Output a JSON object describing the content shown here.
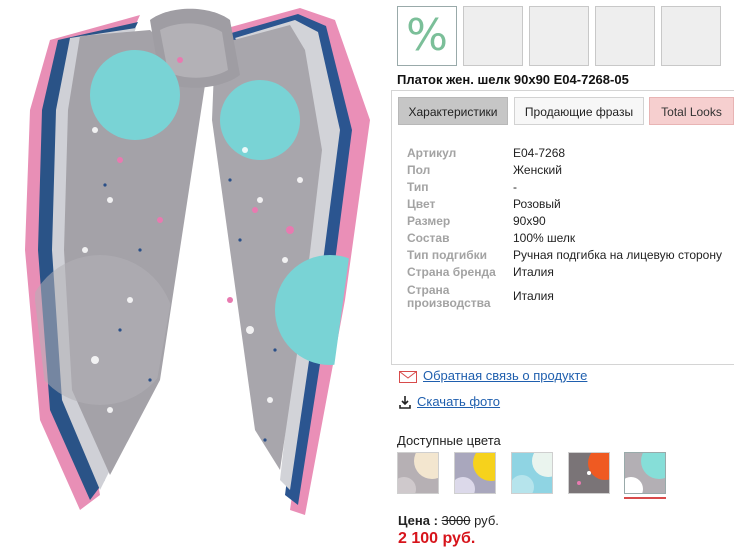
{
  "product": {
    "title": "Платок жен. шелк 90х90 E04-7268-05"
  },
  "thumbnails": [
    {
      "icon": "percent-sign",
      "label": "%"
    },
    {
      "icon": "thumbnail-empty"
    },
    {
      "icon": "thumbnail-empty"
    },
    {
      "icon": "thumbnail-empty"
    },
    {
      "icon": "thumbnail-empty"
    }
  ],
  "tabs": [
    {
      "label": "Характеристики"
    },
    {
      "label": "Продающие фразы"
    },
    {
      "label": "Total Looks"
    }
  ],
  "specs": [
    {
      "label": "Артикул",
      "value": "E04-7268"
    },
    {
      "label": "Пол",
      "value": "Женский"
    },
    {
      "label": "Тип",
      "value": "-"
    },
    {
      "label": "Цвет",
      "value": "Розовый"
    },
    {
      "label": "Размер",
      "value": "90х90"
    },
    {
      "label": "Состав",
      "value": "100% шелк"
    },
    {
      "label": "Тип подгибки",
      "value": "Ручная подгибка на лицевую сторону"
    },
    {
      "label": "Страна бренда",
      "value": "Италия"
    },
    {
      "label": "Страна производства",
      "value": "Италия"
    }
  ],
  "links": {
    "feedback": "Обратная связь о продукте",
    "download": "Скачать фото"
  },
  "colors": {
    "title": "Доступные цвета",
    "swatches": [
      {
        "accent": "#f3e6cf",
        "base": "#b6b0b4"
      },
      {
        "accent": "#f6d21c",
        "base": "#a9a7bd"
      },
      {
        "accent": "#eaf4ee",
        "base": "#8fd4e3"
      },
      {
        "accent": "#ef5a22",
        "base": "#7a7477"
      },
      {
        "accent": "#86ded8",
        "base": "#b3afb4"
      }
    ]
  },
  "price": {
    "label": "Цена :",
    "old": "3000",
    "currency_short": "руб.",
    "new": "2 100 руб."
  }
}
